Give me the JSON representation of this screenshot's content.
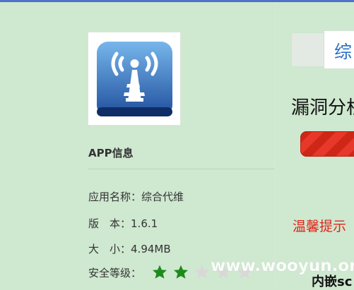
{
  "app": {
    "section_title": "APP信息",
    "name_label": "应用名称：",
    "name_value": "综合代维",
    "version_label": "版　本：",
    "version_value": "1.6.1",
    "size_label": "大　小：",
    "size_value": "4.94MB",
    "security_label": "安全等级：",
    "security_level": 2
  },
  "right_panel": {
    "tab_label": "综",
    "vuln_title": "漏洞分析",
    "warning": "温馨提示",
    "embedded": "内嵌sc"
  },
  "watermark": "www.wooyun.org",
  "colors": {
    "background": "#cfe8d0",
    "accent": "#4d72c9",
    "warning": "#e1241b",
    "progress": "#e8382a"
  },
  "icons": {
    "app_icon": "radio-tower-icon",
    "star_icon": "star-icon"
  }
}
